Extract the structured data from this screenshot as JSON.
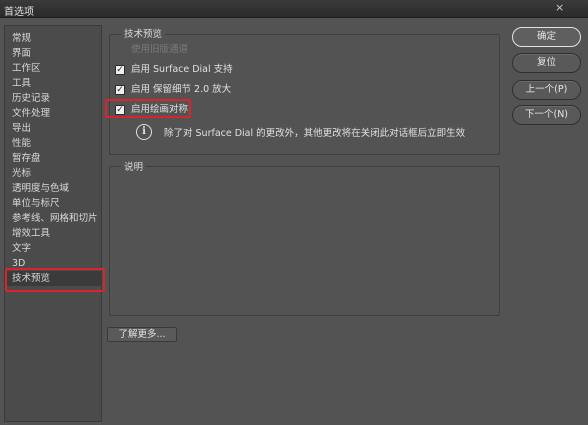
{
  "window": {
    "title": "首选项",
    "close_glyph": "×"
  },
  "sidebar": {
    "items": [
      {
        "label": "常规"
      },
      {
        "label": "界面"
      },
      {
        "label": "工作区"
      },
      {
        "label": "工具"
      },
      {
        "label": "历史记录"
      },
      {
        "label": "文件处理"
      },
      {
        "label": "导出"
      },
      {
        "label": "性能"
      },
      {
        "label": "暂存盘"
      },
      {
        "label": "光标"
      },
      {
        "label": "透明度与色域"
      },
      {
        "label": "单位与标尺"
      },
      {
        "label": "参考线、网格和切片"
      },
      {
        "label": "增效工具"
      },
      {
        "label": "文字"
      },
      {
        "label": "3D"
      },
      {
        "label": "技术预览",
        "selected": true
      }
    ]
  },
  "tech_preview": {
    "title": "技术预览",
    "options": [
      {
        "label": "使用旧版通道",
        "checked": false,
        "disabled": true
      },
      {
        "label": "启用 Surface Dial 支持",
        "checked": true,
        "disabled": false
      },
      {
        "label": "启用 保留细节 2.0 放大",
        "checked": true,
        "disabled": false
      },
      {
        "label": "启用绘画对称",
        "checked": true,
        "disabled": false
      }
    ],
    "info_icon_glyph": "i",
    "info_text": "除了对 Surface Dial 的更改外，其他更改将在关闭此对话框后立即生效"
  },
  "description": {
    "title": "说明"
  },
  "learn_more_label": "了解更多...",
  "buttons": {
    "ok": "确定",
    "reset": "复位",
    "prev": "上一个(P)",
    "next": "下一个(N)"
  },
  "colors": {
    "background": "#535353",
    "highlight": "#d8242a"
  }
}
